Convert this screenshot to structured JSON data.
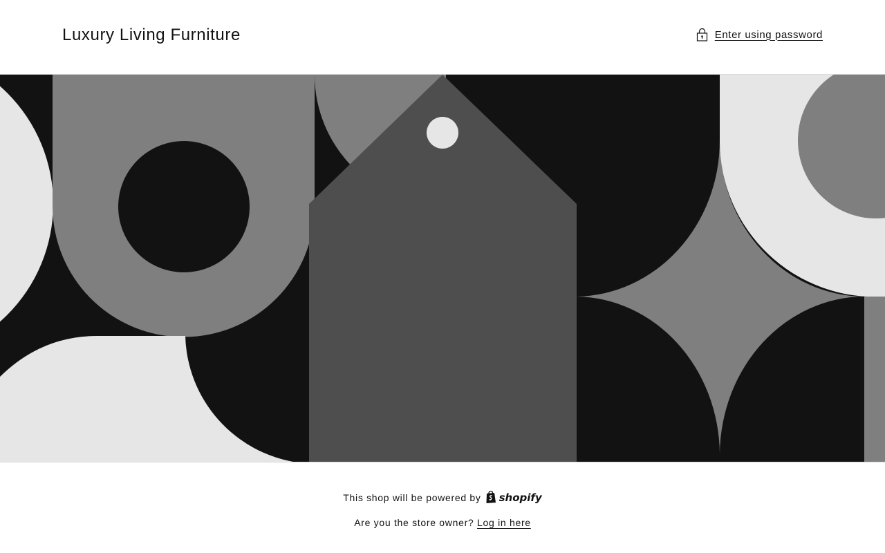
{
  "header": {
    "store_name": "Luxury Living Furniture",
    "password_link_label": "Enter using password",
    "password_icon": "lock-icon"
  },
  "banner": {
    "illustration": "geometric-password-banner",
    "colors": {
      "dark": "#121212",
      "mid": "#7f7f7f",
      "tag": "#4e4e4e",
      "light": "#e6e6e6"
    }
  },
  "footer": {
    "powered_by_text": "This shop will be powered by",
    "shopify_logo_text": "shopify",
    "owner_question": "Are you the store owner?",
    "login_link_label": "Log in here"
  }
}
